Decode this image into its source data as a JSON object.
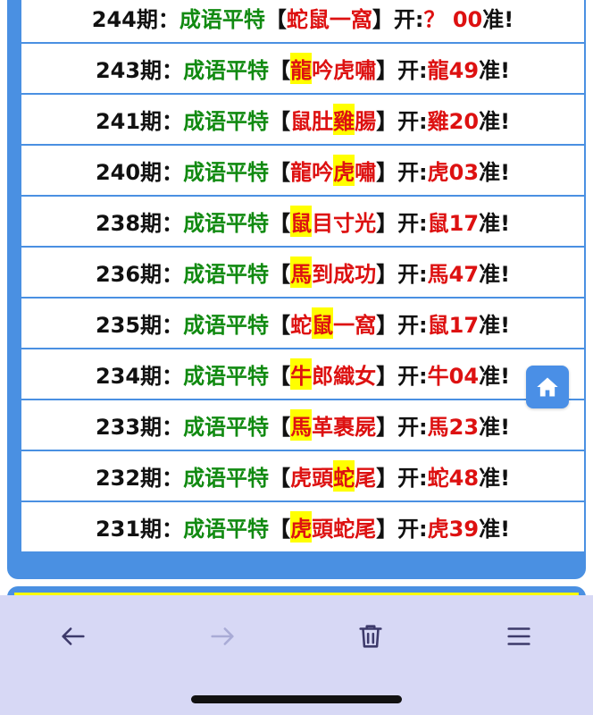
{
  "rows": [
    {
      "issue": "244期：",
      "label": "成语平特",
      "bracket_open": "【",
      "chars": [
        {
          "t": "蛇",
          "hl": false
        },
        {
          "t": "鼠",
          "hl": false
        },
        {
          "t": "一",
          "hl": false
        },
        {
          "t": "窩",
          "hl": false
        }
      ],
      "bracket_close": "】",
      "open_label": "开:",
      "result": "？ 00",
      "suffix": "准!"
    },
    {
      "issue": "243期：",
      "label": "成语平特",
      "bracket_open": "【",
      "chars": [
        {
          "t": "龍",
          "hl": true
        },
        {
          "t": "吟",
          "hl": false
        },
        {
          "t": "虎",
          "hl": false
        },
        {
          "t": "嘯",
          "hl": false
        }
      ],
      "bracket_close": "】",
      "open_label": "开:",
      "result": "龍49",
      "suffix": "准!"
    },
    {
      "issue": "241期：",
      "label": "成语平特",
      "bracket_open": "【",
      "chars": [
        {
          "t": "鼠",
          "hl": false
        },
        {
          "t": "肚",
          "hl": false
        },
        {
          "t": "雞",
          "hl": true
        },
        {
          "t": "腸",
          "hl": false
        }
      ],
      "bracket_close": "】",
      "open_label": "开:",
      "result": "雞20",
      "suffix": "准!"
    },
    {
      "issue": "240期：",
      "label": "成语平特",
      "bracket_open": "【",
      "chars": [
        {
          "t": "龍",
          "hl": false
        },
        {
          "t": "吟",
          "hl": false
        },
        {
          "t": "虎",
          "hl": true
        },
        {
          "t": "嘯",
          "hl": false
        }
      ],
      "bracket_close": "】",
      "open_label": "开:",
      "result": "虎03",
      "suffix": "准!"
    },
    {
      "issue": "238期：",
      "label": "成语平特",
      "bracket_open": "【",
      "chars": [
        {
          "t": "鼠",
          "hl": true
        },
        {
          "t": "目",
          "hl": false
        },
        {
          "t": "寸",
          "hl": false
        },
        {
          "t": "光",
          "hl": false
        }
      ],
      "bracket_close": "】",
      "open_label": "开:",
      "result": "鼠17",
      "suffix": "准!"
    },
    {
      "issue": "236期：",
      "label": "成语平特",
      "bracket_open": "【",
      "chars": [
        {
          "t": "馬",
          "hl": true
        },
        {
          "t": "到",
          "hl": false
        },
        {
          "t": "成",
          "hl": false
        },
        {
          "t": "功",
          "hl": false
        }
      ],
      "bracket_close": "】",
      "open_label": "开:",
      "result": "馬47",
      "suffix": "准!"
    },
    {
      "issue": "235期：",
      "label": "成语平特",
      "bracket_open": "【",
      "chars": [
        {
          "t": "蛇",
          "hl": false
        },
        {
          "t": "鼠",
          "hl": true
        },
        {
          "t": "一",
          "hl": false
        },
        {
          "t": "窩",
          "hl": false
        }
      ],
      "bracket_close": "】",
      "open_label": "开:",
      "result": "鼠17",
      "suffix": "准!"
    },
    {
      "issue": "234期：",
      "label": "成语平特",
      "bracket_open": "【",
      "chars": [
        {
          "t": "牛",
          "hl": true
        },
        {
          "t": "郎",
          "hl": false
        },
        {
          "t": "織",
          "hl": false
        },
        {
          "t": "女",
          "hl": false
        }
      ],
      "bracket_close": "】",
      "open_label": "开:",
      "result": "牛04",
      "suffix": "准!"
    },
    {
      "issue": "233期：",
      "label": "成语平特",
      "bracket_open": "【",
      "chars": [
        {
          "t": "馬",
          "hl": true
        },
        {
          "t": "革",
          "hl": false
        },
        {
          "t": "裹",
          "hl": false
        },
        {
          "t": "屍",
          "hl": false
        }
      ],
      "bracket_close": "】",
      "open_label": "开:",
      "result": "馬23",
      "suffix": "准!"
    },
    {
      "issue": "232期：",
      "label": "成语平特",
      "bracket_open": "【",
      "chars": [
        {
          "t": "虎",
          "hl": false
        },
        {
          "t": "頭",
          "hl": false
        },
        {
          "t": "蛇",
          "hl": true
        },
        {
          "t": "尾",
          "hl": false
        }
      ],
      "bracket_close": "】",
      "open_label": "开:",
      "result": "蛇48",
      "suffix": "准!"
    },
    {
      "issue": "231期：",
      "label": "成语平特",
      "bracket_open": "【",
      "chars": [
        {
          "t": "虎",
          "hl": true
        },
        {
          "t": "頭",
          "hl": false
        },
        {
          "t": "蛇",
          "hl": false
        },
        {
          "t": "尾",
          "hl": false
        }
      ],
      "bracket_close": "】",
      "open_label": "开:",
      "result": "虎39",
      "suffix": "准!"
    }
  ],
  "icons": {
    "home": "home-icon",
    "back": "arrow-left-icon",
    "forward": "arrow-right-icon",
    "delete": "trash-icon",
    "menu": "menu-icon"
  },
  "browser": {
    "forward_disabled": true
  },
  "colors": {
    "panel_border": "#4a90e2",
    "highlight": "#ffff00",
    "label_green": "#118a11",
    "result_red": "#dd1111",
    "browser_bar": "#d7d8f5",
    "icon_dark": "#3d3a6b",
    "icon_disabled": "#a9abd6"
  }
}
